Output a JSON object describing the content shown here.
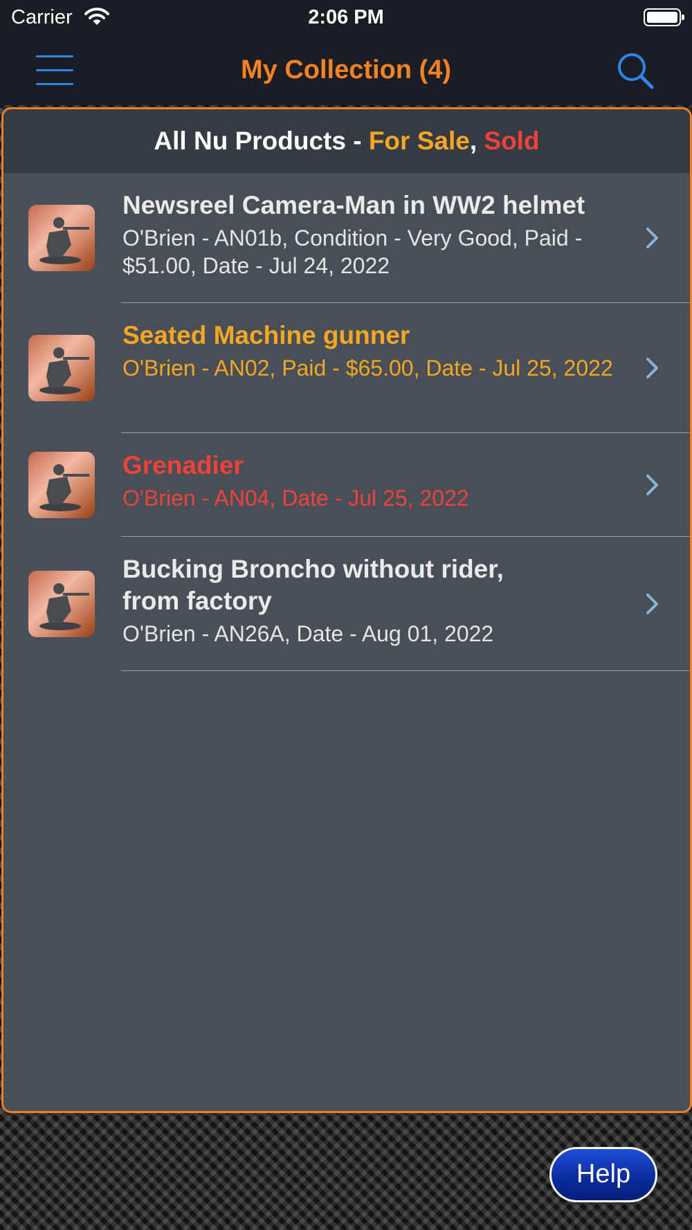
{
  "status_bar": {
    "carrier": "Carrier",
    "time": "2:06 PM"
  },
  "nav": {
    "title": "My Collection (4)",
    "menu_icon": "hamburger-menu-icon",
    "search_icon": "search-icon",
    "accent": "#f58220",
    "icon_color": "#2f86f0"
  },
  "header": {
    "prefix": "All Nu Products - ",
    "for_sale": "For Sale",
    "comma": ", ",
    "sold": "Sold"
  },
  "items": [
    {
      "title": "Newsreel Camera-Man in WW2 helmet",
      "subtitle": "O'Brien - AN01b, Condition - Very Good, Paid - $51.00, Date - Jul 24, 2022",
      "status": "owned"
    },
    {
      "title": "Seated Machine gunner",
      "subtitle": "O'Brien - AN02, Paid - $65.00, Date - Jul 25, 2022",
      "status": "for-sale"
    },
    {
      "title": "Grenadier",
      "subtitle": "O'Brien - AN04, Date - Jul 25, 2022",
      "status": "sold"
    },
    {
      "title": "Bucking Broncho without rider, from factory",
      "subtitle": "O'Brien - AN26A, Date - Aug 01, 2022",
      "status": "owned"
    }
  ],
  "help": {
    "label": "Help"
  },
  "colors": {
    "for_sale": "#f5a623",
    "sold": "#f0413b",
    "panel_border": "#f07f22"
  }
}
